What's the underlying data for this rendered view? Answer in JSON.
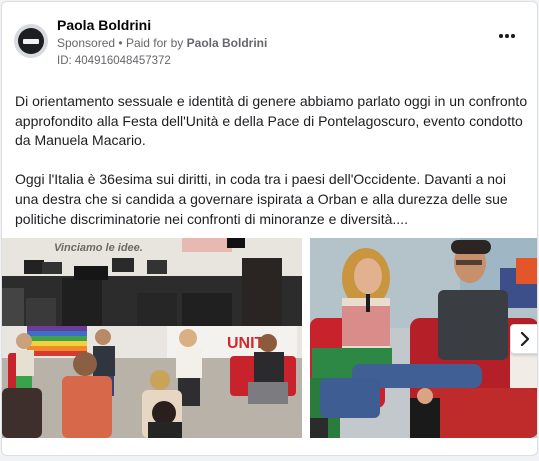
{
  "advertiser": {
    "name": "Paola Boldrini",
    "sponsored_label": "Sponsored",
    "separator": "•",
    "paid_for_prefix": "Paid for by",
    "paid_for_name": "Paola Boldrini",
    "ad_id": "ID: 404916048457372",
    "avatar_icon": "blocked-avatar-icon"
  },
  "post": {
    "paragraph_1": "Di orientamento sessuale e identità di genere abbiamo parlato oggi in un confronto approfondito alla Festa dell'Unità e della Pace di Pontelagoscuro, evento condotto da Manuela Macario.",
    "paragraph_2": "Oggi l'Italia è 36esima sui diritti, in coda tra i paesi dell'Occidente. Davanti a noi una destra che si candida a governare ispirata a Orban e alla durezza delle sue politiche discriminatorie nei confronti di minoranze e diversità...."
  },
  "media": {
    "image_1_banner_text": "Vinciamo le idee.",
    "image_1_sign_text": "UNIT",
    "next_icon": "chevron-right-icon",
    "more_icon": "more-options-icon"
  },
  "colors": {
    "text_primary": "#050505",
    "text_secondary": "#65676b",
    "card_border": "#dddfe2",
    "page_bg": "#f0f2f5",
    "chair_red": "#c8232c"
  }
}
